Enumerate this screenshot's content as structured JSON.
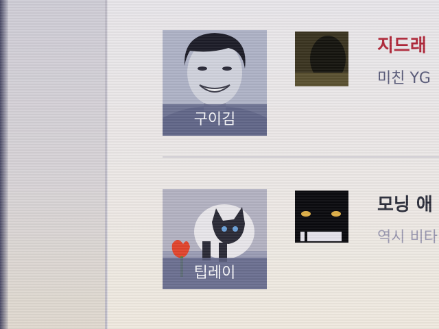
{
  "feed": {
    "items": [
      {
        "avatar_label": "구이김",
        "title": "지드래",
        "subtitle": "미친 YG"
      },
      {
        "avatar_label": "팁레이",
        "title": "모닝 애",
        "subtitle": "역시 비타"
      }
    ]
  },
  "colors": {
    "title_accent": "#b0283a",
    "subtitle_muted": "#9a98b0",
    "avatar_overlay": "#5f6487"
  }
}
